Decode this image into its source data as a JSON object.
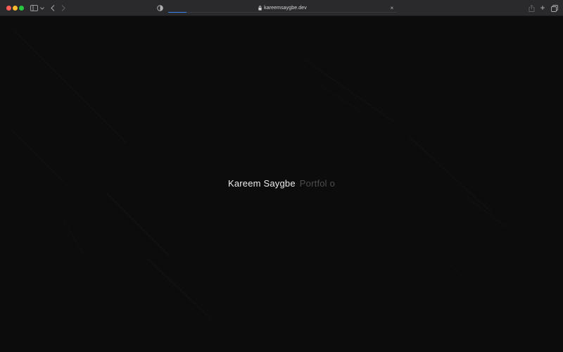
{
  "browser": {
    "url": "kareemsaygbe.dev",
    "icons": {
      "sidebar": "sidebar-icon",
      "chevron": "chevron-down-icon",
      "back": "back-icon",
      "forward": "forward-icon",
      "privacy": "shield-icon",
      "lock": "lock-icon",
      "stop": "close-icon",
      "share": "share-icon",
      "new_tab": "plus-icon",
      "tab_overview": "tabs-icon"
    },
    "stop_glyph": "×",
    "new_tab_glyph": "+",
    "load_progress": 0.08,
    "colors": {
      "close": "#ff5f57",
      "minimize": "#febc2e",
      "maximize": "#28c840",
      "toolbar": "#2a2a2c",
      "progress": "#3b82f6"
    }
  },
  "page": {
    "hero": {
      "name": "Kareem Saygbe",
      "subtitle": "Portfol o"
    },
    "colors": {
      "background": "#0c0c0c",
      "name": "#ececec",
      "subtitle": "#4d4d50"
    }
  }
}
